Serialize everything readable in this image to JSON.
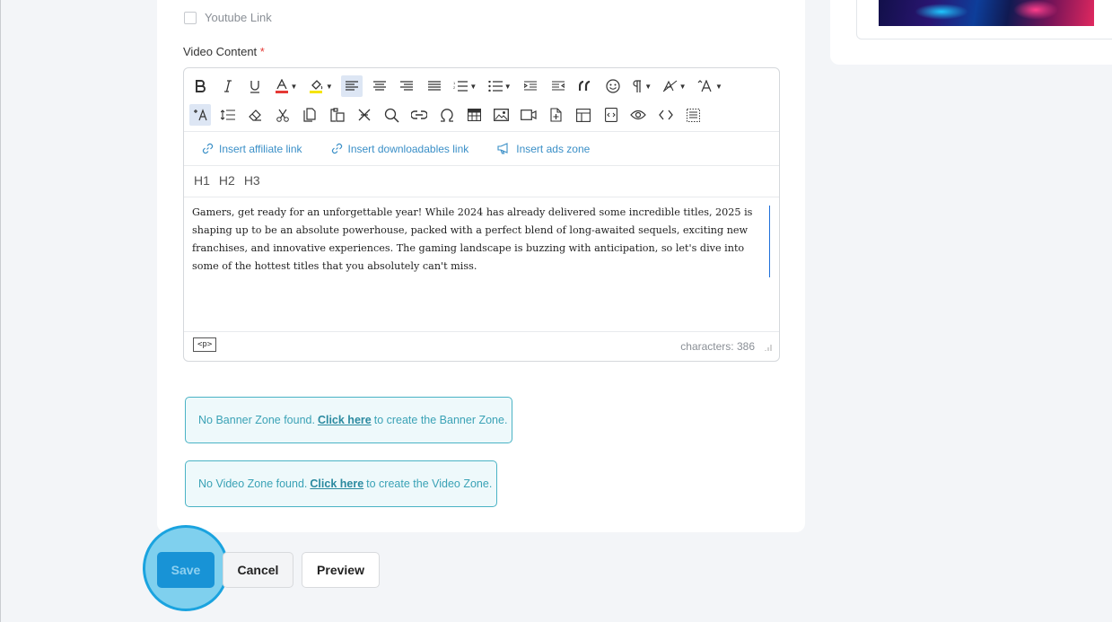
{
  "youtube": {
    "label": "Youtube Link",
    "checked": false
  },
  "video_content": {
    "label": "Video Content",
    "required_mark": "*"
  },
  "toolbar": {
    "row1": [
      "bold-icon",
      "italic-icon",
      "underline-icon",
      "text-color-icon",
      "highlight-color-icon",
      "align-left-icon",
      "align-center-icon",
      "align-right-icon",
      "align-justify-icon",
      "ordered-list-icon",
      "unordered-list-icon",
      "indent-icon",
      "outdent-icon",
      "quote-icon",
      "emoji-icon",
      "paragraph-icon",
      "line-height-icon",
      "font-size-icon"
    ],
    "row2": [
      "clear-format-icon",
      "line-spacing-icon",
      "eraser-icon",
      "cut-icon",
      "copy-icon",
      "paste-icon",
      "strikethrough-clear-icon",
      "search-icon",
      "link-icon",
      "omega-icon",
      "table-icon",
      "image-icon",
      "video-icon",
      "insert-file-icon",
      "template-icon",
      "embed-code-icon",
      "preview-icon",
      "source-code-icon",
      "select-all-icon"
    ],
    "text_color": "#e53935",
    "highlight_color": "#f5e400"
  },
  "insert_links": {
    "affiliate": "Insert affiliate link",
    "downloadables": "Insert downloadables link",
    "ads_zone": "Insert ads zone"
  },
  "headings": [
    "H1",
    "H2",
    "H3"
  ],
  "content": {
    "text": "Gamers, get ready for an unforgettable year! While 2024 has already delivered some incredible titles, 2025 is shaping up to be an absolute powerhouse, packed with a perfect blend of long-awaited sequels, exciting new franchises, and innovative experiences. The gaming landscape is buzzing with anticipation, so let's dive into some of the hottest titles that you absolutely can't miss."
  },
  "status": {
    "path": "<p>",
    "characters": "characters: 386"
  },
  "banner_zone": {
    "prefix": "No Banner Zone found.",
    "link": "Click here",
    "suffix": "to create the Banner Zone."
  },
  "video_zone": {
    "prefix": "No Video Zone found.",
    "link": "Click here",
    "suffix": "to create the Video Zone."
  },
  "actions": {
    "save": "Save",
    "cancel": "Cancel",
    "preview": "Preview"
  },
  "colors": {
    "accent": "#1893d6",
    "zone_border": "#4ab3c5",
    "link_blue": "#3a8fc7"
  }
}
